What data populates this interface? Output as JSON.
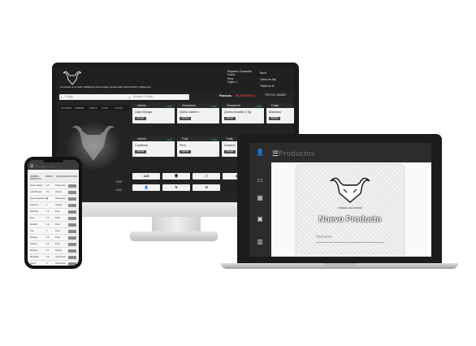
{
  "desktop": {
    "header": {
      "tagline": "Los sueños no se hacen realidad por arte de magia, necesita sudor, determinación y trabajo duro.",
      "empresa": "Empresa: Ghostsolid",
      "fecha": "Fecha:",
      "hora": "Hora:",
      "cajero": "Cajero: 1",
      "items": "Ítem",
      "total_bs": "Total en Bs",
      "total_usd": "Total en $"
    },
    "search_placeholder": "Código",
    "search_products_placeholder": "Nombre / Código",
    "factura_label": "Factura:",
    "factura_number": "00-00000015",
    "tipo_cambio": "TIPO DE CAMBIO",
    "columns": [
      "CANTIDAD",
      "NOMBRE",
      "PRECIO",
      "TOTAL",
      "ACCIÓN"
    ],
    "products": [
      {
        "category": "Libreria",
        "stock": "1-500",
        "name": "Lápiz Mongol",
        "action": "Agregar"
      },
      {
        "category": "Charcutería",
        "stock": "1-500",
        "name": "Queso Llanero",
        "action": "Agregar"
      },
      {
        "category": "Charcutería",
        "stock": "1-500",
        "name": "Queso Amarillo X Kg",
        "action": "Agregar"
      },
      {
        "category": "Frutas",
        "stock": "",
        "name": "Manzana",
        "action": "Agregar"
      },
      {
        "category": "Libreria",
        "stock": "1-500",
        "name": "Cuaderno",
        "action": "Agregar"
      },
      {
        "category": "Fruta",
        "stock": "1-500",
        "name": "Pera",
        "action": "Agregar"
      },
      {
        "category": "Fruta",
        "stock": "1-500",
        "name": "Durazno",
        "action": "Agregar"
      },
      {
        "category": "Fruta",
        "stock": "",
        "name": "",
        "action": "Agregar"
      }
    ],
    "keypad": [
      "123",
      "",
      "",
      "$"
    ],
    "values": [
      "0.00",
      "0.00"
    ]
  },
  "laptop": {
    "title": "Productos",
    "form_title": "Nuevo Producto",
    "field_label": "Nombre",
    "brand": "TORRES ESCUDERO",
    "sidebar_icons": [
      "user-icon",
      "monitor-icon",
      "boxes-icon",
      "inbox-icon",
      "chart-icon"
    ]
  },
  "phone": {
    "title": "Productos",
    "columns": [
      "NOMBRE PRODUCTO",
      "PRECIO",
      "CATEGORIA",
      "ACCIONES"
    ],
    "rows": [
      {
        "name": "Queso Llanero",
        "price": "4.5",
        "category": "Charcutería"
      },
      {
        "name": "Lápiz Mongol",
        "price": "0.5",
        "category": "Libreria"
      },
      {
        "name": "Queso Amarillo X Kg",
        "price": "6",
        "category": "Charcutería"
      },
      {
        "name": "Cuaderno",
        "price": "2",
        "category": "Libreria"
      },
      {
        "name": "Manzana",
        "price": "1.5",
        "category": "Fruta"
      },
      {
        "name": "Pera",
        "price": "1.2",
        "category": "Fruta"
      },
      {
        "name": "Durazno",
        "price": "1.8",
        "category": "Fruta"
      },
      {
        "name": "Uva",
        "price": "3",
        "category": "Fruta"
      },
      {
        "name": "Naranja",
        "price": "0.8",
        "category": "Fruta"
      },
      {
        "name": "Cambur",
        "price": "0.6",
        "category": "Fruta"
      },
      {
        "name": "Borrador",
        "price": "0.3",
        "category": "Libreria"
      },
      {
        "name": "Mortadela",
        "price": "3.5",
        "category": "Charcutería"
      },
      {
        "name": "Jamón",
        "price": "5",
        "category": "Charcutería"
      }
    ]
  }
}
